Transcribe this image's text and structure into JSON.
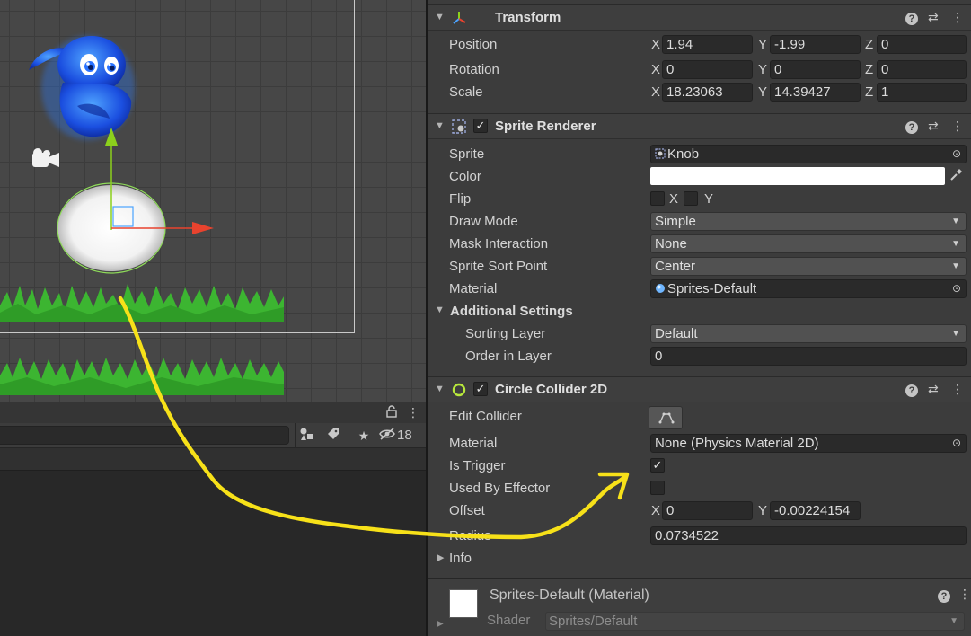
{
  "lower_panel": {
    "hidden_count": "18"
  },
  "transform": {
    "title": "Transform",
    "position": {
      "label": "Position",
      "x": "1.94",
      "y": "-1.99",
      "z": "0"
    },
    "rotation": {
      "label": "Rotation",
      "x": "0",
      "y": "0",
      "z": "0"
    },
    "scale": {
      "label": "Scale",
      "x": "18.23063",
      "y": "14.39427",
      "z": "1"
    }
  },
  "axis_labels": {
    "x": "X",
    "y": "Y",
    "z": "Z"
  },
  "sprite_renderer": {
    "title": "Sprite Renderer",
    "enabled": true,
    "sprite_label": "Sprite",
    "sprite_value": "Knob",
    "color_label": "Color",
    "color_value": "#ffffff",
    "flip_label": "Flip",
    "flip_x_label": "X",
    "flip_y_label": "Y",
    "draw_mode_label": "Draw Mode",
    "draw_mode_value": "Simple",
    "mask_label": "Mask Interaction",
    "mask_value": "None",
    "sort_point_label": "Sprite Sort Point",
    "sort_point_value": "Center",
    "material_label": "Material",
    "material_value": "Sprites-Default",
    "additional_label": "Additional Settings",
    "sorting_layer_label": "Sorting Layer",
    "sorting_layer_value": "Default",
    "order_label": "Order in Layer",
    "order_value": "0"
  },
  "circle_collider": {
    "title": "Circle Collider 2D",
    "enabled": true,
    "edit_label": "Edit Collider",
    "material_label": "Material",
    "material_value": "None (Physics Material 2D)",
    "trigger_label": "Is Trigger",
    "is_trigger": true,
    "effector_label": "Used By Effector",
    "used_by_effector": false,
    "offset_label": "Offset",
    "offset_x": "0",
    "offset_y": "-0.00224154",
    "radius_label": "Radius",
    "radius_value": "0.0734522",
    "info_label": "Info"
  },
  "material_footer": {
    "title": "Sprites-Default (Material)",
    "shader_label": "Shader",
    "shader_value": "Sprites/Default"
  },
  "colors": {
    "gizmo_x": "#e8432e",
    "gizmo_y": "#8cd11c",
    "annotation": "#f7e119",
    "collider": "#8fdc5a"
  }
}
